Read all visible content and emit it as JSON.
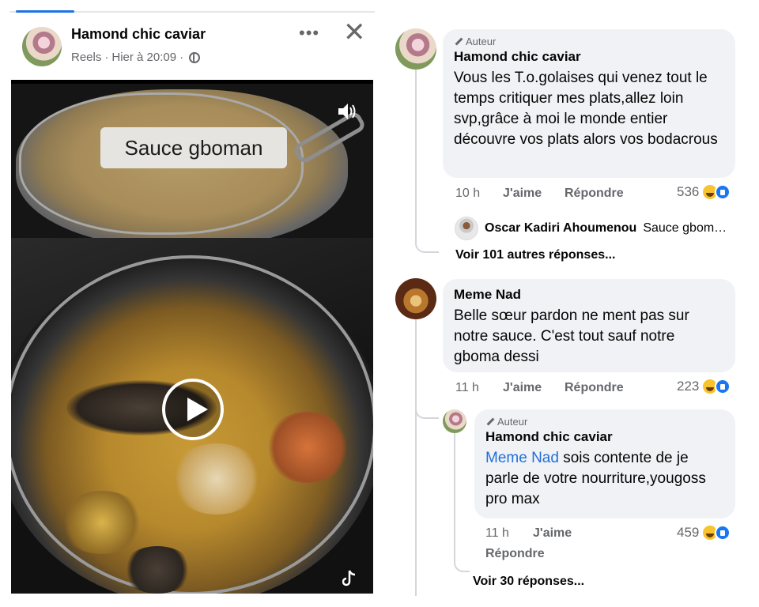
{
  "post": {
    "author": "Hamond chic caviar",
    "meta_reels": "Reels",
    "meta_dot": "·",
    "meta_time": "Hier à 20:09",
    "meta_dot2": "·",
    "more_icon": "•••",
    "close_icon": "✕",
    "video": {
      "label": "Sauce gboman"
    }
  },
  "comments": [
    {
      "badge": "Auteur",
      "name": "Hamond chic caviar",
      "text": "Vous les T.o.golaises qui venez tout le temps critiquer mes plats,allez loin svp,grâce à moi le monde entier découvre vos plats alors vos bodacrous",
      "time": "10 h",
      "like": "J'aime",
      "reply": "Répondre",
      "reactions": "536",
      "reply_preview": {
        "name": "Oscar Kadiri Ahoumenou",
        "text": "Sauce gbom…"
      },
      "more_replies": "Voir 101 autres réponses..."
    },
    {
      "name": "Meme Nad",
      "text": "Belle sœur pardon ne ment pas sur notre sauce. C'est tout sauf notre gboma dessi",
      "time": "11 h",
      "like": "J'aime",
      "reply": "Répondre",
      "reactions": "223",
      "nested": {
        "badge": "Auteur",
        "name": "Hamond chic caviar",
        "mention": "Meme Nad",
        "text": " sois contente de je parle de votre nourriture,yougoss pro max",
        "time": "11 h",
        "like": "J'aime",
        "reply": "Répondre",
        "reactions": "459"
      },
      "more_replies": "Voir 30 réponses..."
    }
  ],
  "colors": {
    "accent": "#1877f2",
    "bubble": "#f0f2f5",
    "secondary_text": "#65676b"
  }
}
